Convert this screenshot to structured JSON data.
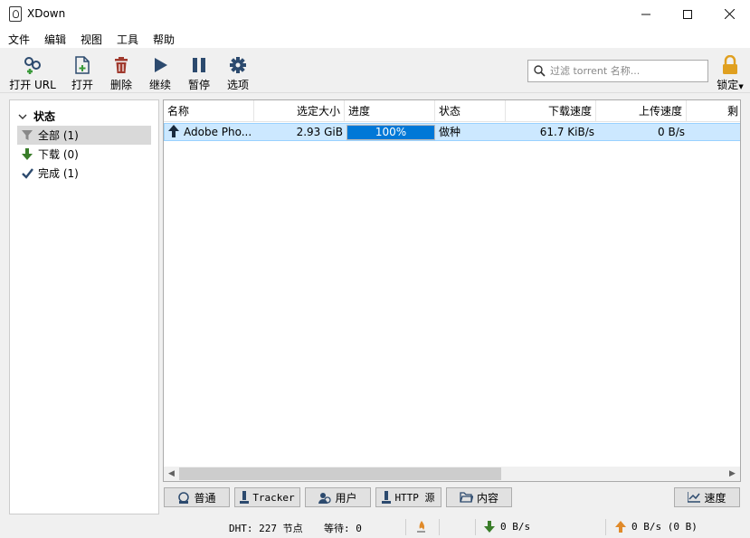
{
  "window": {
    "title": "XDown"
  },
  "menu": [
    "文件",
    "编辑",
    "视图",
    "工具",
    "帮助"
  ],
  "toolbar": {
    "open_url": "打开 URL",
    "open": "打开",
    "delete": "删除",
    "resume": "继续",
    "pause": "暂停",
    "options": "选项",
    "lock": "锁定"
  },
  "search": {
    "placeholder": "过滤 torrent 名称..."
  },
  "sidebar": {
    "header": "状态",
    "items": [
      {
        "label": "全部 (1)",
        "icon": "filter-icon"
      },
      {
        "label": "下载 (0)",
        "icon": "arrow-down-icon"
      },
      {
        "label": "完成 (1)",
        "icon": "checkmark-icon"
      }
    ]
  },
  "table": {
    "columns": [
      "名称",
      "选定大小",
      "进度",
      "状态",
      "下载速度",
      "上传速度",
      "剩"
    ],
    "rows": [
      {
        "name": "Adobe Pho...",
        "size": "2.93 GiB",
        "progress_text": "100%",
        "progress": 1.0,
        "status": "做种",
        "dl_speed": "61.7 KiB/s",
        "ul_speed": "0 B/s"
      }
    ]
  },
  "tabs": {
    "general": "普通",
    "tracker": "Tracker",
    "peers": "用户",
    "http": "HTTP 源",
    "content": "内容",
    "speed": "速度"
  },
  "status": {
    "dht": "DHT: 227 节点",
    "waiting": "等待: 0",
    "download": "0 B/s",
    "upload": "0 B/s (0 B)"
  },
  "colors": {
    "accent": "#0078d7",
    "selection": "#cce8ff",
    "delete": "#a03a2e",
    "toolbar_icon": "#2c4a6e"
  }
}
